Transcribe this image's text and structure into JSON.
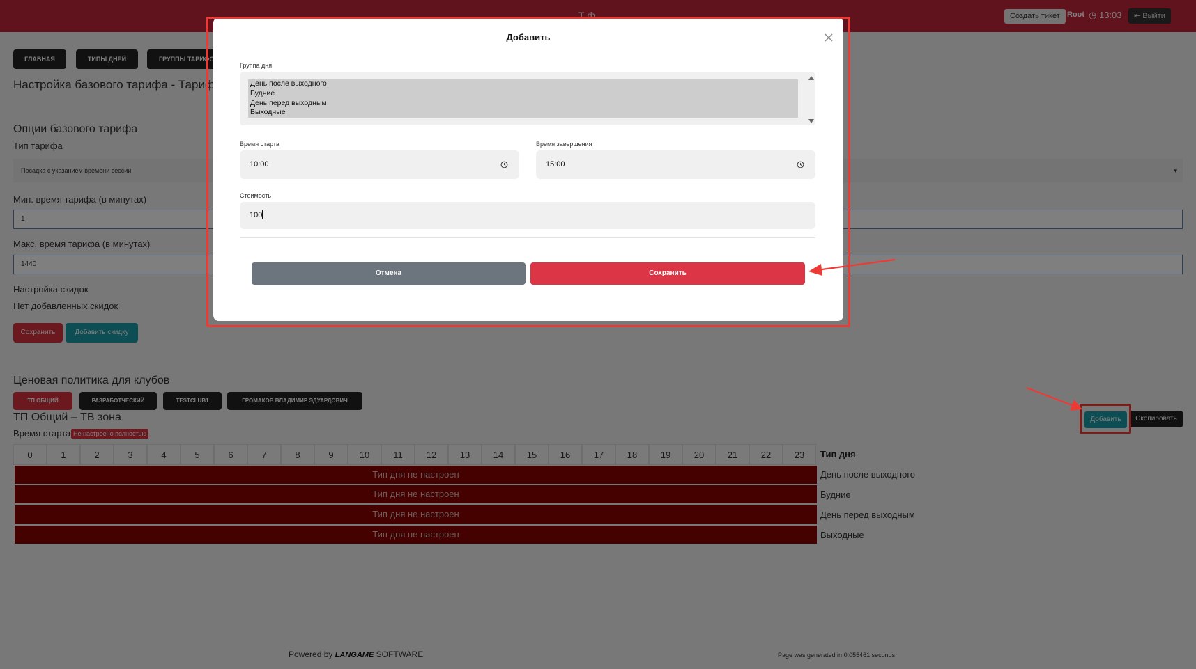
{
  "topbar": {
    "brand": "Т  ф",
    "ticket_button": "Создать тикет",
    "user": "Root",
    "clock": "13:03",
    "logout_button": "Выйти"
  },
  "nav": [
    "ГЛАВНАЯ",
    "ТИПЫ ДНЕЙ",
    "ГРУППЫ ТАРИФОВ"
  ],
  "page": {
    "title": "Настройка базового тарифа - Тариф \"Li",
    "options_title": "Опции базового тарифа",
    "tariff_type_label": "Тип тарифа",
    "tariff_type_value": "Посадка с указанием времени сессии",
    "min_time_label": "Мин. время тарифа (в минутах)",
    "min_time_value": "1",
    "max_time_label": "Макс. время тарифа (в минутах)",
    "max_time_value": "1440",
    "discount_label": "Настройка скидок",
    "no_discounts_link": "Нет добавленных скидок",
    "save_button": "Сохранить",
    "add_discount_button": "Добавить скидку"
  },
  "pricing": {
    "title": "Ценовая политика для клубов",
    "clubs": [
      "ТП ОБЩИЙ",
      "РАЗРАБОТЧЕСКИЙ",
      "TESTCLUB1",
      "ГРОМАКОВ ВЛАДИМИР ЭДУАРДОВИЧ"
    ],
    "zone_title": "ТП Общий – ТВ зона",
    "start_time_label": "Время старта",
    "not_configured_badge": "Не настроено полностью",
    "add_button": "Добавить",
    "copy_button": "Скопировать",
    "hours": [
      "0",
      "1",
      "2",
      "3",
      "4",
      "5",
      "6",
      "7",
      "8",
      "9",
      "10",
      "11",
      "12",
      "13",
      "14",
      "15",
      "16",
      "17",
      "18",
      "19",
      "20",
      "21",
      "22",
      "23"
    ],
    "day_type_header": "Тип дня",
    "rows": [
      {
        "status": "Тип дня не настроен",
        "day": "День после выходного"
      },
      {
        "status": "Тип дня не настроен",
        "day": "Будние"
      },
      {
        "status": "Тип дня не настроен",
        "day": "День перед выходным"
      },
      {
        "status": "Тип дня не настроен",
        "day": "Выходные"
      }
    ]
  },
  "footer": {
    "powered_prefix": "Powered by ",
    "logo": "LANGAME",
    "powered_suffix": " SOFTWARE",
    "generated": "Page was generated in 0.055461 seconds"
  },
  "modal": {
    "title": "Добавить",
    "day_group_label": "Группа дня",
    "day_group_options": [
      "День после выходного",
      "Будние",
      "День перед выходным",
      "Выходные"
    ],
    "start_time_label": "Время старта",
    "start_time_value": "10:00",
    "end_time_label": "Время завершения",
    "end_time_value": "15:00",
    "cost_label": "Стоимость",
    "cost_value": "100",
    "cancel_button": "Отмена",
    "save_button": "Сохранить"
  },
  "colors": {
    "brand_red": "#c3263a",
    "danger": "#dc3545",
    "teal": "#1a9ba8",
    "annotation": "#ee3a35"
  }
}
